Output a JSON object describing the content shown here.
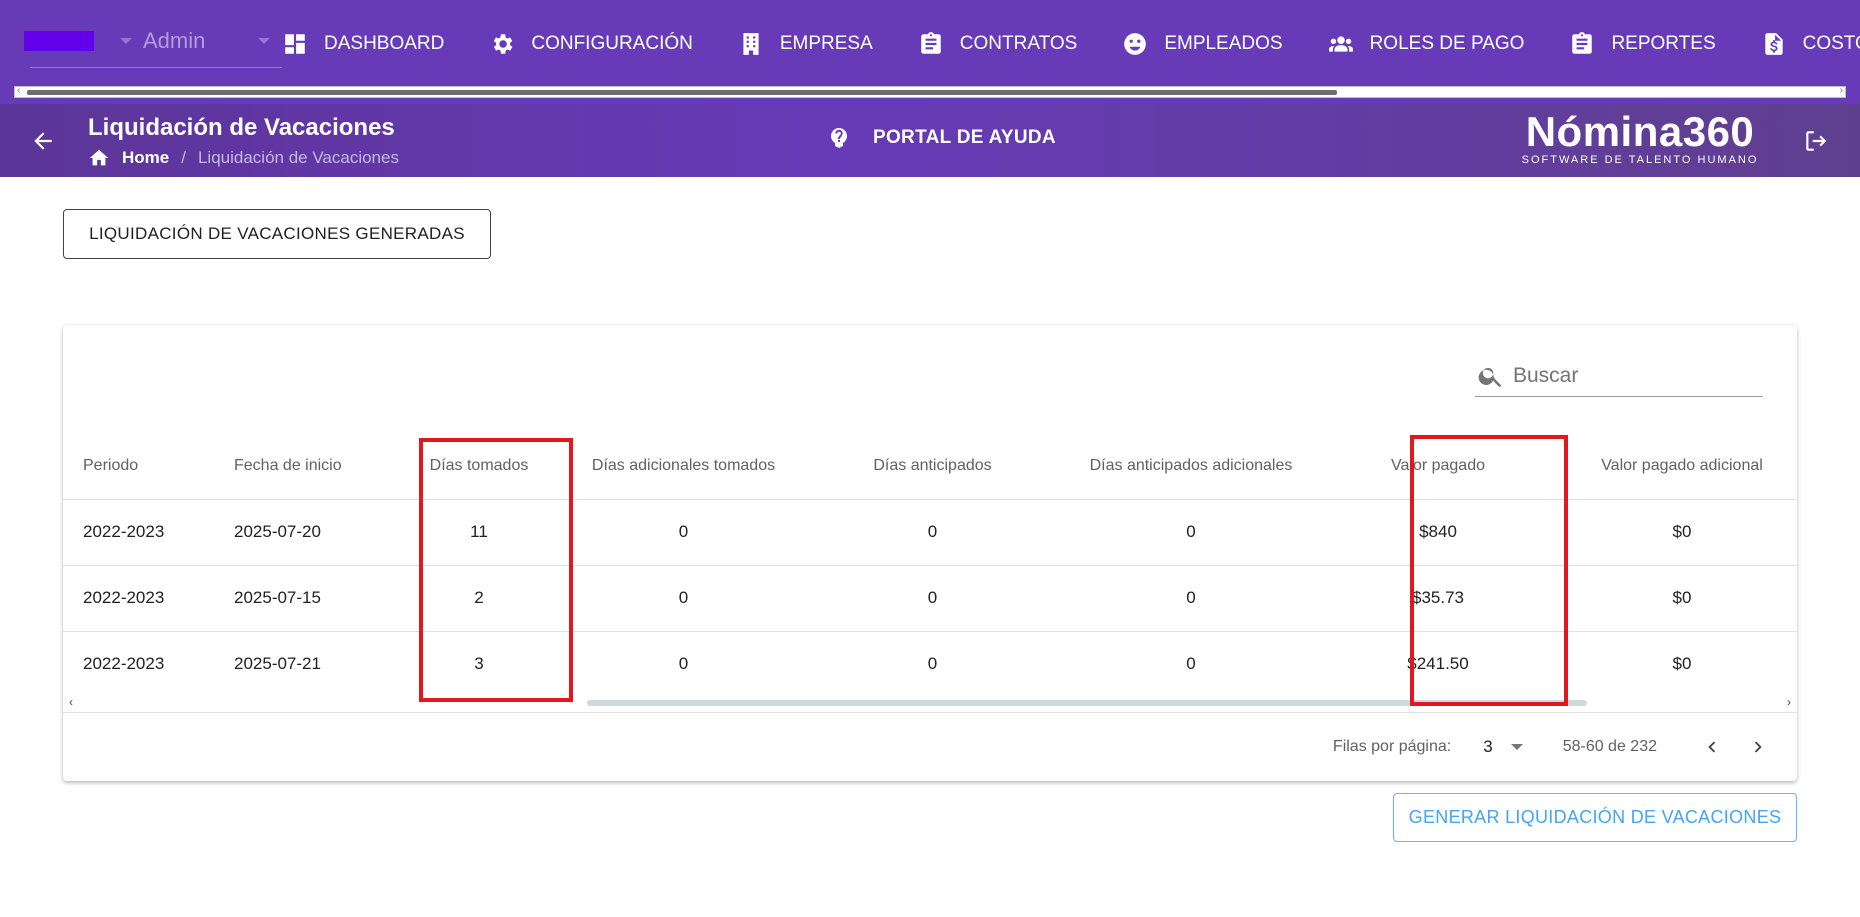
{
  "topbar": {
    "org_color": "#6200ea",
    "user_role": "Admin",
    "nav": [
      {
        "label": "DASHBOARD",
        "icon": "dashboard-icon"
      },
      {
        "label": "CONFIGURACIÓN",
        "icon": "gear-icon"
      },
      {
        "label": "EMPRESA",
        "icon": "building-icon"
      },
      {
        "label": "CONTRATOS",
        "icon": "clipboard-icon"
      },
      {
        "label": "EMPLEADOS",
        "icon": "face-icon"
      },
      {
        "label": "ROLES DE PAGO",
        "icon": "group-icon"
      },
      {
        "label": "REPORTES",
        "icon": "clipboard-icon"
      },
      {
        "label": "COSTOS",
        "icon": "invoice-dollar-icon"
      }
    ]
  },
  "subheader": {
    "title": "Liquidación de Vacaciones",
    "breadcrumb_home": "Home",
    "breadcrumb_sep": "/",
    "breadcrumb_current": "Liquidación de Vacaciones",
    "help_label": "PORTAL DE AYUDA",
    "logo_main": "Nómina360",
    "logo_sub": "SOFTWARE DE TALENTO HUMANO"
  },
  "generated_button": "LIQUIDACIÓN DE VACACIONES GENERADAS",
  "search": {
    "placeholder": "Buscar",
    "value": ""
  },
  "table": {
    "columns": [
      "Periodo",
      "Fecha de inicio",
      "Días tomados",
      "Días adicionales tomados",
      "Días anticipados",
      "Días anticipados adicionales",
      "Valor pagado",
      "Valor pagado adicional"
    ],
    "rows": [
      [
        "2022-2023",
        "2025-07-20",
        "11",
        "0",
        "0",
        "0",
        "$840",
        "$0"
      ],
      [
        "2022-2023",
        "2025-07-15",
        "2",
        "0",
        "0",
        "0",
        "$35.73",
        "$0"
      ],
      [
        "2022-2023",
        "2025-07-21",
        "3",
        "0",
        "0",
        "0",
        "$241.50",
        "$0"
      ]
    ]
  },
  "pagination": {
    "rows_per_page_label": "Filas por página:",
    "rows_per_page": "3",
    "range": "58-60 de 232"
  },
  "highlight_color": "#e0191f",
  "generate_button": "GENERAR LIQUIDACIÓN DE VACACIONES"
}
